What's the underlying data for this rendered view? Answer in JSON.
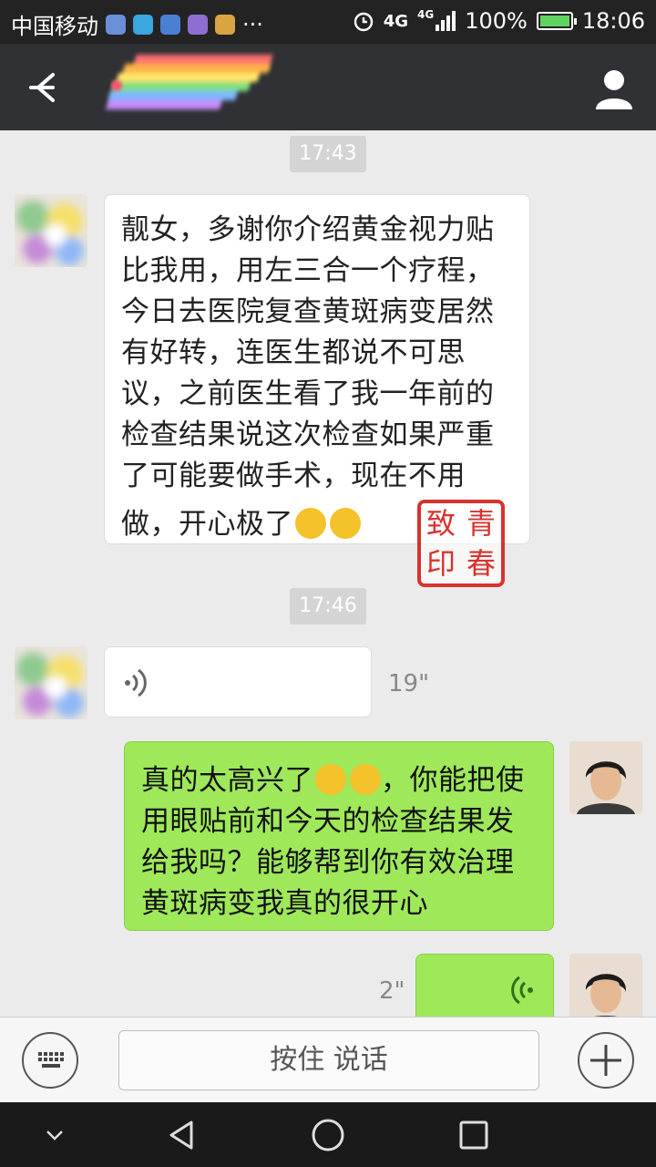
{
  "status_bar": {
    "carrier": "中国移动",
    "more": "···",
    "network": "4G",
    "network2": "4G",
    "battery": "100%",
    "time": "18:06"
  },
  "header": {
    "back_icon": "arrow-left-icon",
    "profile_icon": "person-icon"
  },
  "messages": {
    "time1": "17:43",
    "msg1": [
      "靓女，多谢你介绍黄金视力贴",
      "比我用，用左三合一个疗程，",
      "今日去医院复查黄斑病变居然",
      "有好转，连医生都说不可思",
      "议，之前医生看了我一年前的",
      "检查结果说这次检查如果严重",
      "了可能要做手术，现在不用",
      "做，开心极了"
    ],
    "seal": [
      "致",
      "青",
      "印",
      "春"
    ],
    "time2": "17:46",
    "voice1_duration": "19\"",
    "msg2": [
      "真的太高兴了",
      "，你能把使",
      "用眼贴前和今天的检查结果发",
      "给我吗？能够帮到你有效治理",
      "黄斑病变我真的很开心"
    ],
    "voice2_duration": "2\""
  },
  "input_bar": {
    "hold_to_talk": "按住 说话"
  },
  "colors": {
    "chat_bg": "#ebebeb",
    "sent_bubble": "#9ee85a",
    "received_bubble": "#ffffff",
    "header_bg": "#2f3134"
  }
}
